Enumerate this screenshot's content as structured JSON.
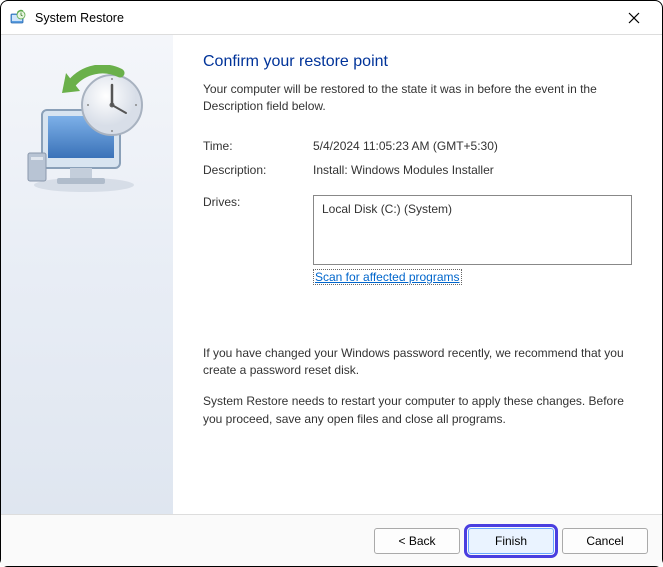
{
  "titlebar": {
    "title": "System Restore"
  },
  "main": {
    "heading": "Confirm your restore point",
    "subtitle": "Your computer will be restored to the state it was in before the event in the Description field below.",
    "time_label": "Time:",
    "time_value": "5/4/2024 11:05:23 AM (GMT+5:30)",
    "desc_label": "Description:",
    "desc_value": "Install: Windows Modules Installer",
    "drives_label": "Drives:",
    "drives_value": "Local Disk (C:) (System)",
    "scan_link": "Scan for affected programs",
    "warning1": "If you have changed your Windows password recently, we recommend that you create a password reset disk.",
    "warning2": "System Restore needs to restart your computer to apply these changes. Before you proceed, save any open files and close all programs."
  },
  "footer": {
    "back": "< Back",
    "finish": "Finish",
    "cancel": "Cancel"
  }
}
